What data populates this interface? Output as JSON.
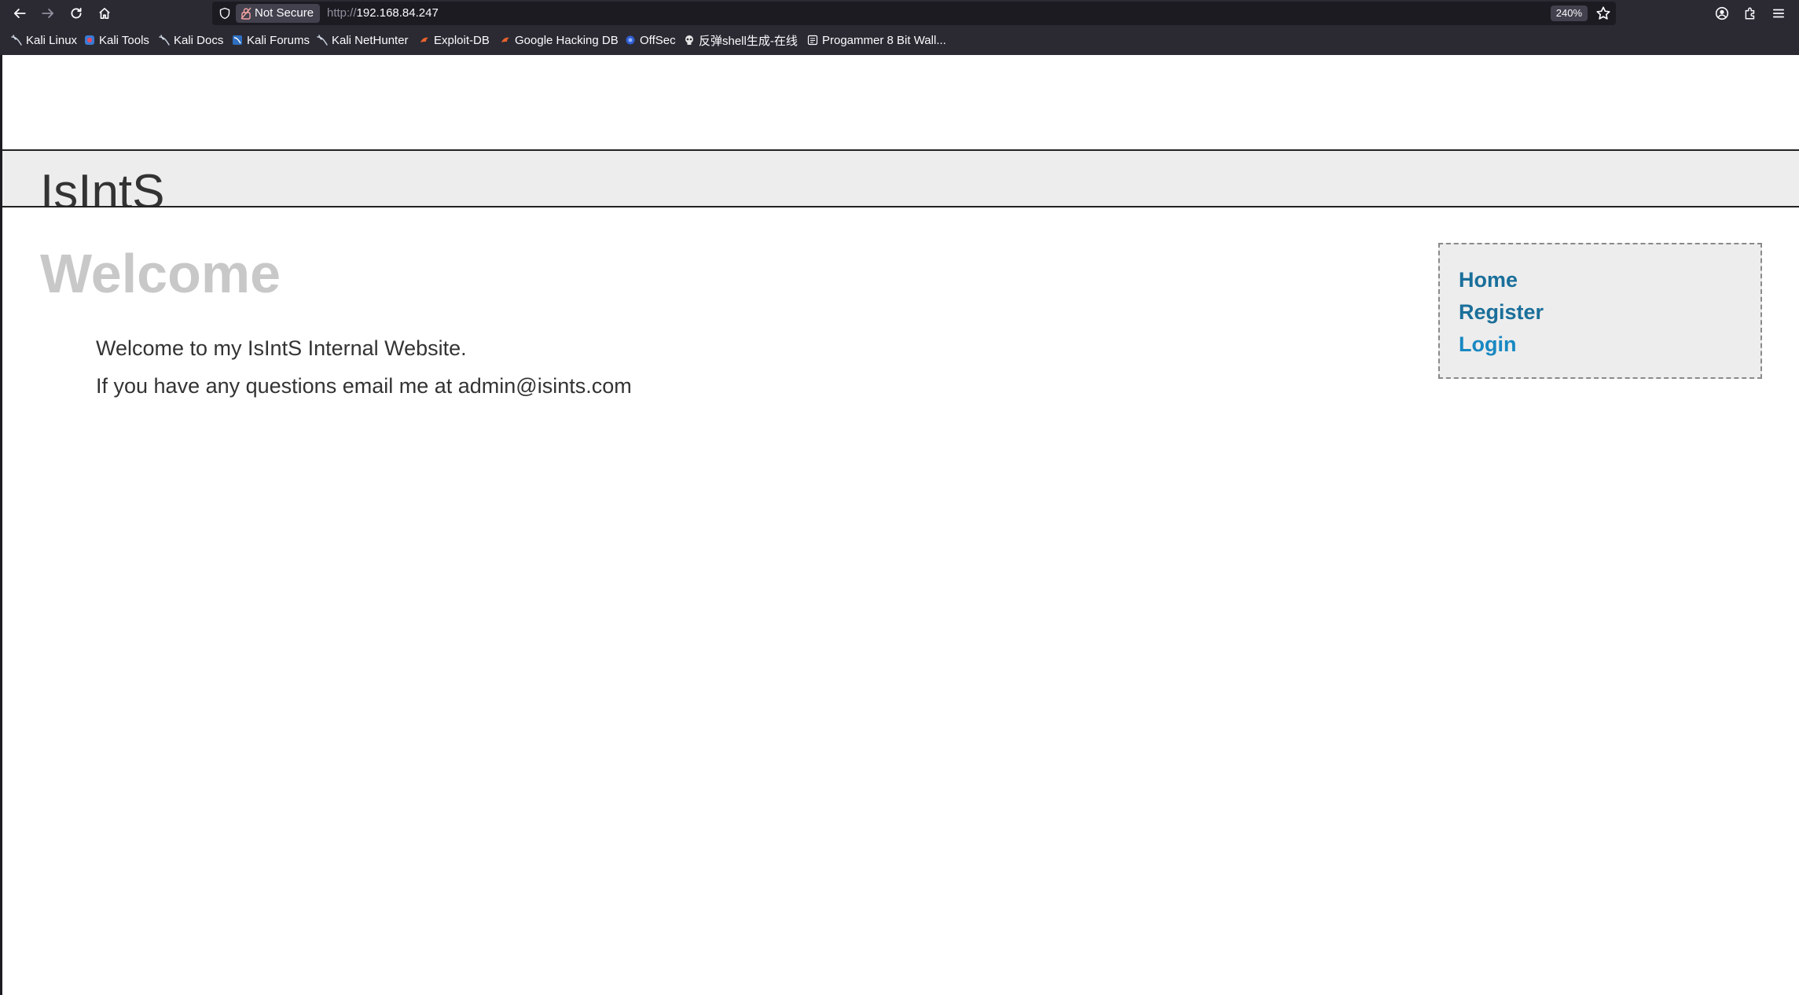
{
  "browser": {
    "security_label": "Not Secure",
    "url_scheme": "http://",
    "url_host": "192.168.84.247",
    "zoom": "240%",
    "bookmarks": [
      {
        "label": "Kali Linux",
        "icon": "kali-dragon-icon"
      },
      {
        "label": "Kali Tools",
        "icon": "kali-tools-icon"
      },
      {
        "label": "Kali Docs",
        "icon": "kali-dragon-icon"
      },
      {
        "label": "Kali Forums",
        "icon": "kali-forums-icon"
      },
      {
        "label": "Kali NetHunter",
        "icon": "kali-dragon-icon"
      },
      {
        "label": "Exploit-DB",
        "icon": "exploit-db-icon"
      },
      {
        "label": "Google Hacking DB",
        "icon": "exploit-db-icon"
      },
      {
        "label": "OffSec",
        "icon": "offsec-icon"
      },
      {
        "label": "反弹shell生成-在线",
        "icon": "skull-icon"
      },
      {
        "label": "Progammer 8 Bit Wall...",
        "icon": "page-icon"
      }
    ]
  },
  "site": {
    "title": "IsIntS",
    "heading": "Welcome",
    "paragraphs": [
      "Welcome to my IsIntS Internal Website.",
      "If you have any questions email me at admin@isints.com"
    ],
    "nav": {
      "home": "Home",
      "register": "Register",
      "login": "Login"
    }
  },
  "colors": {
    "chrome_bg": "#2b2a33",
    "urlbar_bg": "#1c1b22",
    "header_band": "#ededed",
    "heading": "#c8c8c8",
    "link": "#1a6f9a",
    "link_hover": "#1888c2"
  }
}
